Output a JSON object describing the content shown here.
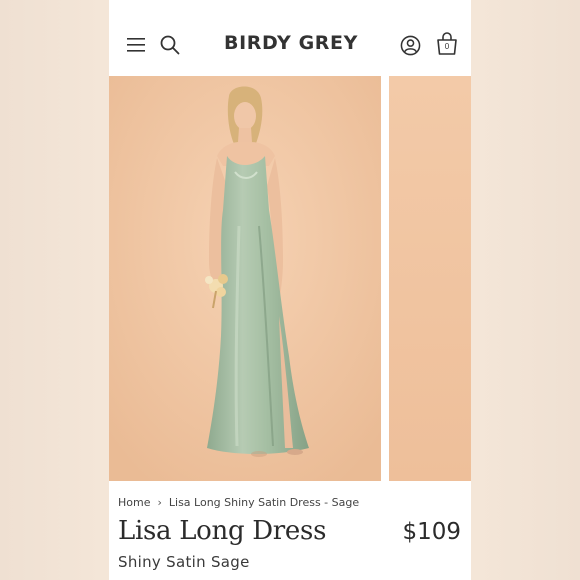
{
  "header": {
    "brand": "BIRDY GREY",
    "bag_count": "0",
    "icons": [
      "menu-icon",
      "search-icon",
      "account-icon",
      "bag-icon"
    ]
  },
  "gallery": {
    "main_image": "model-in-sage-satin-dress",
    "next_image": "peach-background-photo"
  },
  "breadcrumb": {
    "home": "Home",
    "current": "Lisa Long Shiny Satin Dress - Sage"
  },
  "product": {
    "title": "Lisa Long Dress",
    "price": "$109",
    "subtitle": "Shiny Satin Sage"
  },
  "colors": {
    "backdrop": "#f2c8a6",
    "dress": "#a9c2a8",
    "text": "#2b2b2b"
  }
}
